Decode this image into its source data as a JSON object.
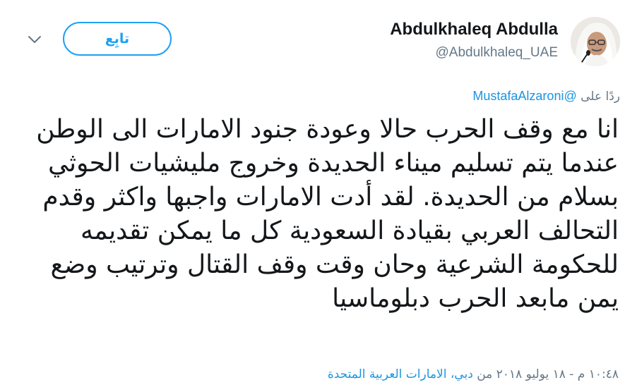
{
  "user": {
    "display_name": "Abdulkhaleq Abdulla",
    "handle": "@Abdulkhaleq_UAE"
  },
  "header": {
    "follow_label": "تابِع"
  },
  "reply": {
    "prefix": "ردًا على",
    "mention": "@MustafaAlzaroni"
  },
  "tweet": {
    "text": "انا مع وقف الحرب حالا وعودة جنود الامارات الى الوطن عندما يتم تسليم ميناء الحديدة وخروج مليشيات الحوثي بسلام من الحديدة. لقد أدت الامارات واجبها واكثر وقدم التحالف العربي بقيادة السعودية كل ما يمكن تقديمه للحكومة الشرعية وحان وقت وقف القتال وترتيب وضع يمن مابعد الحرب دبلوماسيا"
  },
  "meta": {
    "timestamp": "١٠:٤٨ م - ١٨ يوليو ٢٠١٨",
    "from_word": "من",
    "place": "دبي، الامارات العربية المتحدة"
  },
  "colors": {
    "accent": "#1da1f2",
    "link": "#1b95e0",
    "secondary_text": "#657786",
    "primary_text": "#14171a"
  },
  "icons": {
    "avatar": "avatar",
    "caret": "chevron-down-icon"
  }
}
